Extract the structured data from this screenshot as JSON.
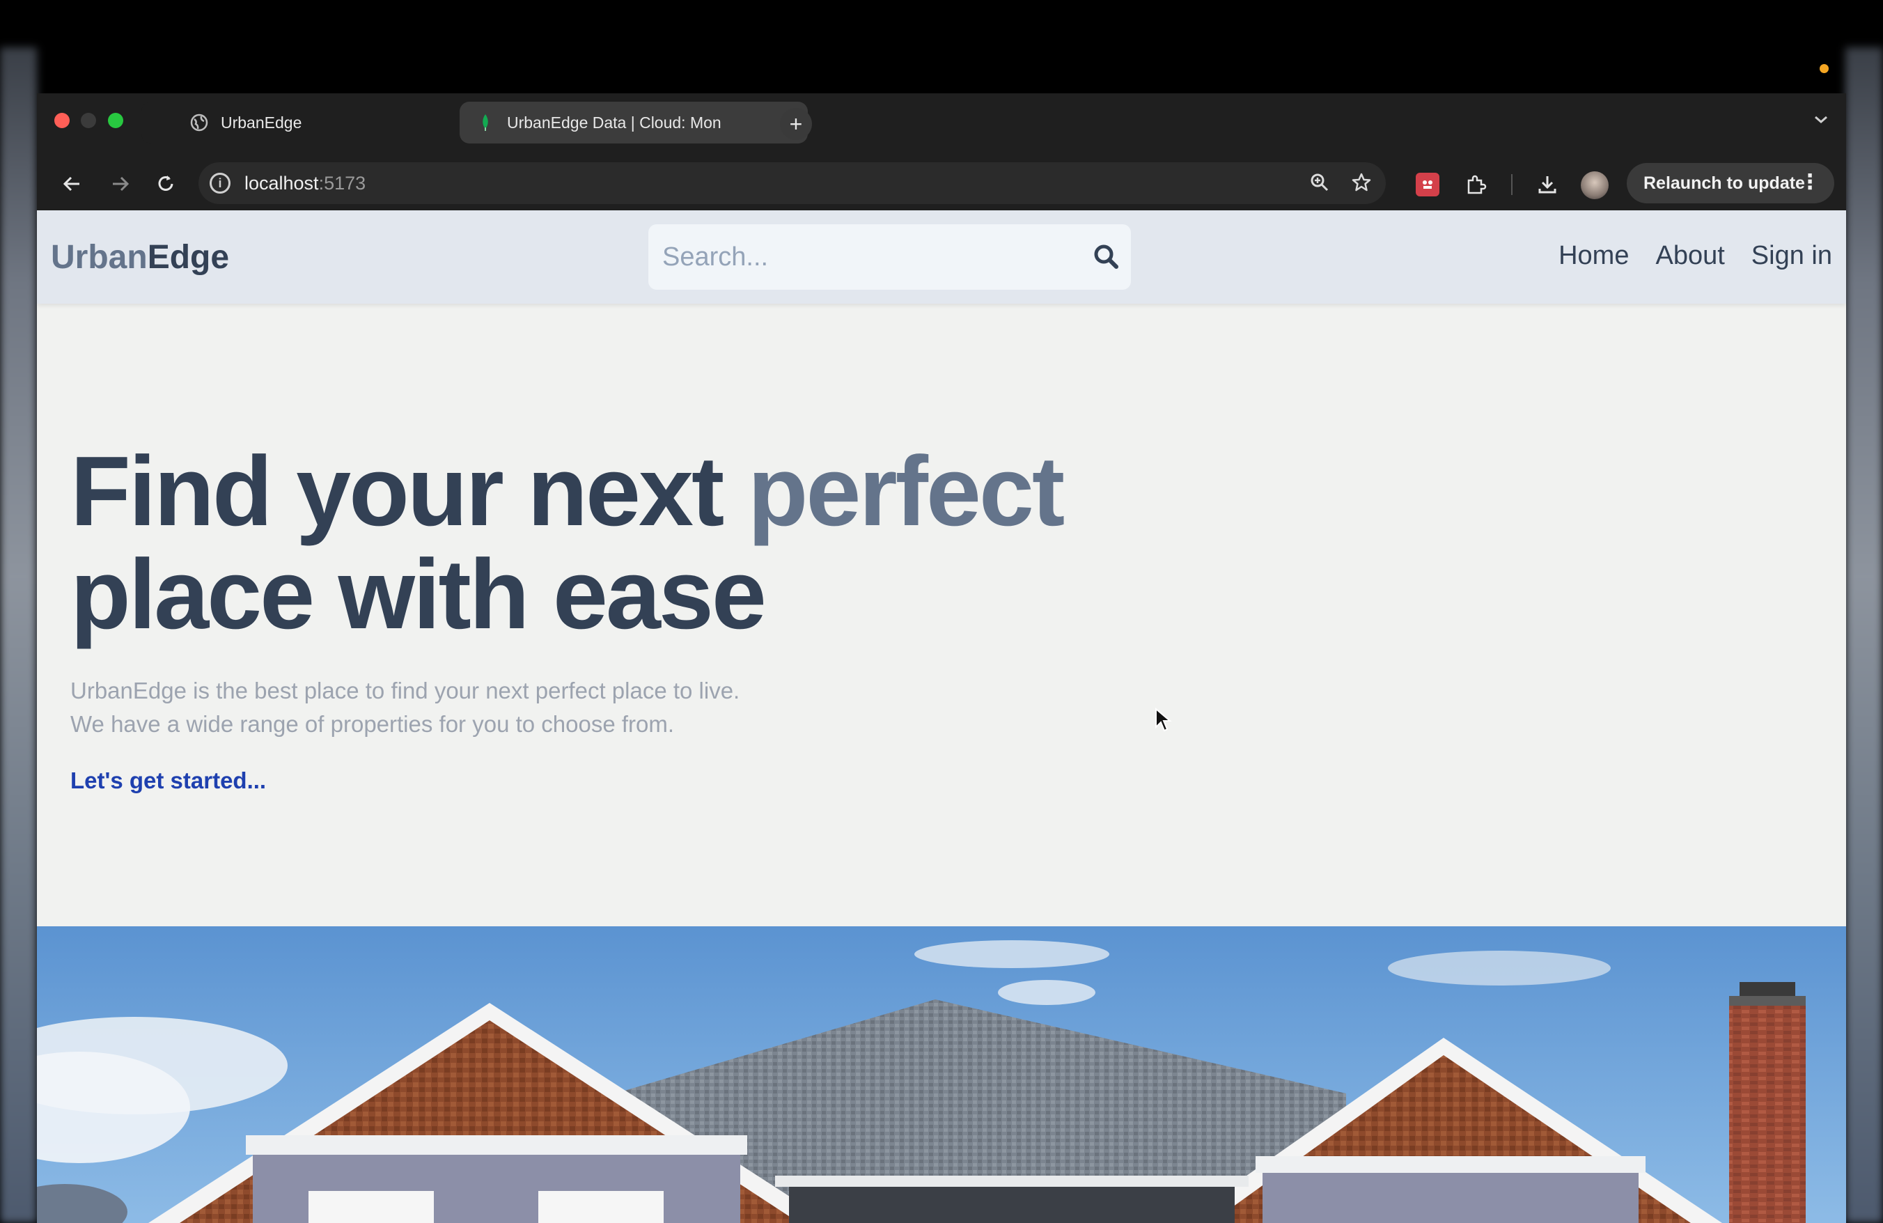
{
  "browser": {
    "tabs": [
      {
        "title": "UrbanEdge",
        "close": "✕"
      },
      {
        "title": "UrbanEdge Data | Cloud: Mon",
        "close": "✕"
      }
    ],
    "new_tab": "+",
    "url_host": "localhost",
    "url_port": ":5173",
    "relaunch_label": "Relaunch to update",
    "colors": {
      "chrome": "#1f1f1f",
      "close": "#ff5f57",
      "zoom": "#28c840"
    }
  },
  "header": {
    "logo_part1": "Urban",
    "logo_part2": "Edge",
    "search_placeholder": "Search...",
    "nav": [
      "Home",
      "About",
      "Sign in"
    ]
  },
  "hero": {
    "headline_part1": "Find your next ",
    "headline_accent": "perfect",
    "headline_part2": "place with ease",
    "subtitle_line1": "UrbanEdge is the best place to find your next perfect place to live.",
    "subtitle_line2": "We have a wide range of properties for you to choose from.",
    "cta": "Let's get started..."
  },
  "colors": {
    "heading": "#334155",
    "accent": "#64748b",
    "link": "#1e40af",
    "header_bg": "#e2e7ee",
    "page_bg": "#f1f2f0"
  }
}
